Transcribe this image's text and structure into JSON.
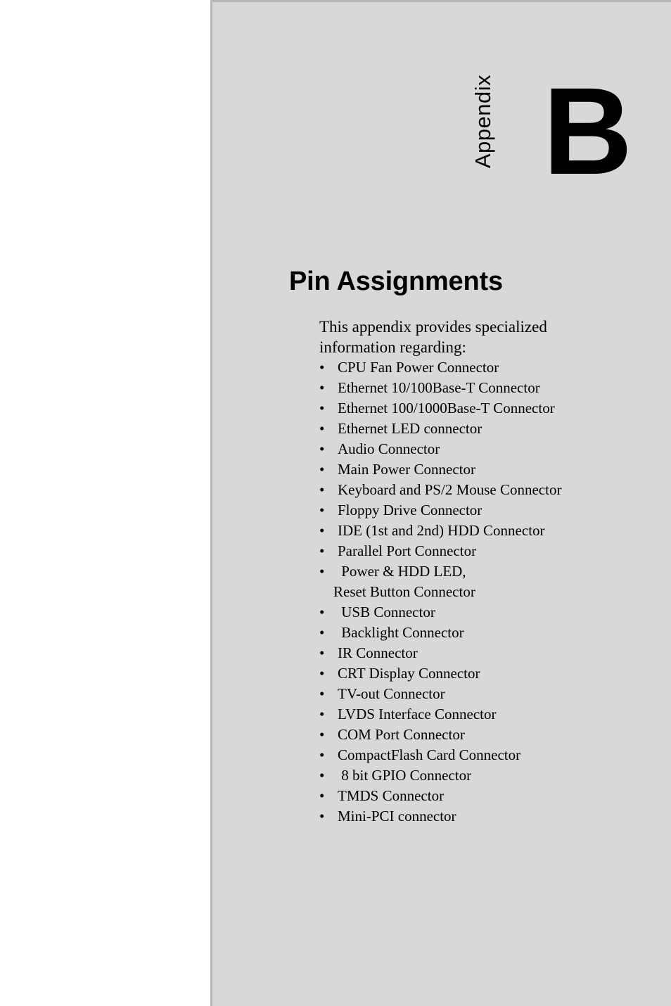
{
  "page": {
    "background_color": "#d8d8d8",
    "margin_color": "#ffffff",
    "border_color": "#b6b6b6"
  },
  "header": {
    "appendix_word": "Appendix",
    "appendix_letter": "B"
  },
  "title": "Pin Assignments",
  "intro": "This appendix provides specialized information regarding:",
  "bullet_char": "•",
  "topics": [
    {
      "label": "CPU Fan Power Connector"
    },
    {
      "label": "Ethernet 10/100Base-T Connector"
    },
    {
      "label": "Ethernet 100/1000Base-T Connector"
    },
    {
      "label": "Ethernet LED connector"
    },
    {
      "label": "Audio Connector"
    },
    {
      "label": "Main Power Connector"
    },
    {
      "label": "Keyboard and PS/2 Mouse Connector"
    },
    {
      "label": "Floppy Drive Connector"
    },
    {
      "label": "IDE (1st and 2nd) HDD Connector"
    },
    {
      "label": "Parallel Port Connector"
    },
    {
      "label": " Power & HDD LED,",
      "label2": "Reset Button Connector"
    },
    {
      "label": " USB Connector"
    },
    {
      "label": " Backlight Connector"
    },
    {
      "label": "IR Connector"
    },
    {
      "label": "CRT Display Connector"
    },
    {
      "label": "TV-out Connector"
    },
    {
      "label": "LVDS Interface Connector"
    },
    {
      "label": "COM Port Connector"
    },
    {
      "label": "CompactFlash Card Connector"
    },
    {
      "label": " 8 bit GPIO Connector"
    },
    {
      "label": "TMDS Connector"
    },
    {
      "label": "Mini-PCI connector"
    }
  ]
}
